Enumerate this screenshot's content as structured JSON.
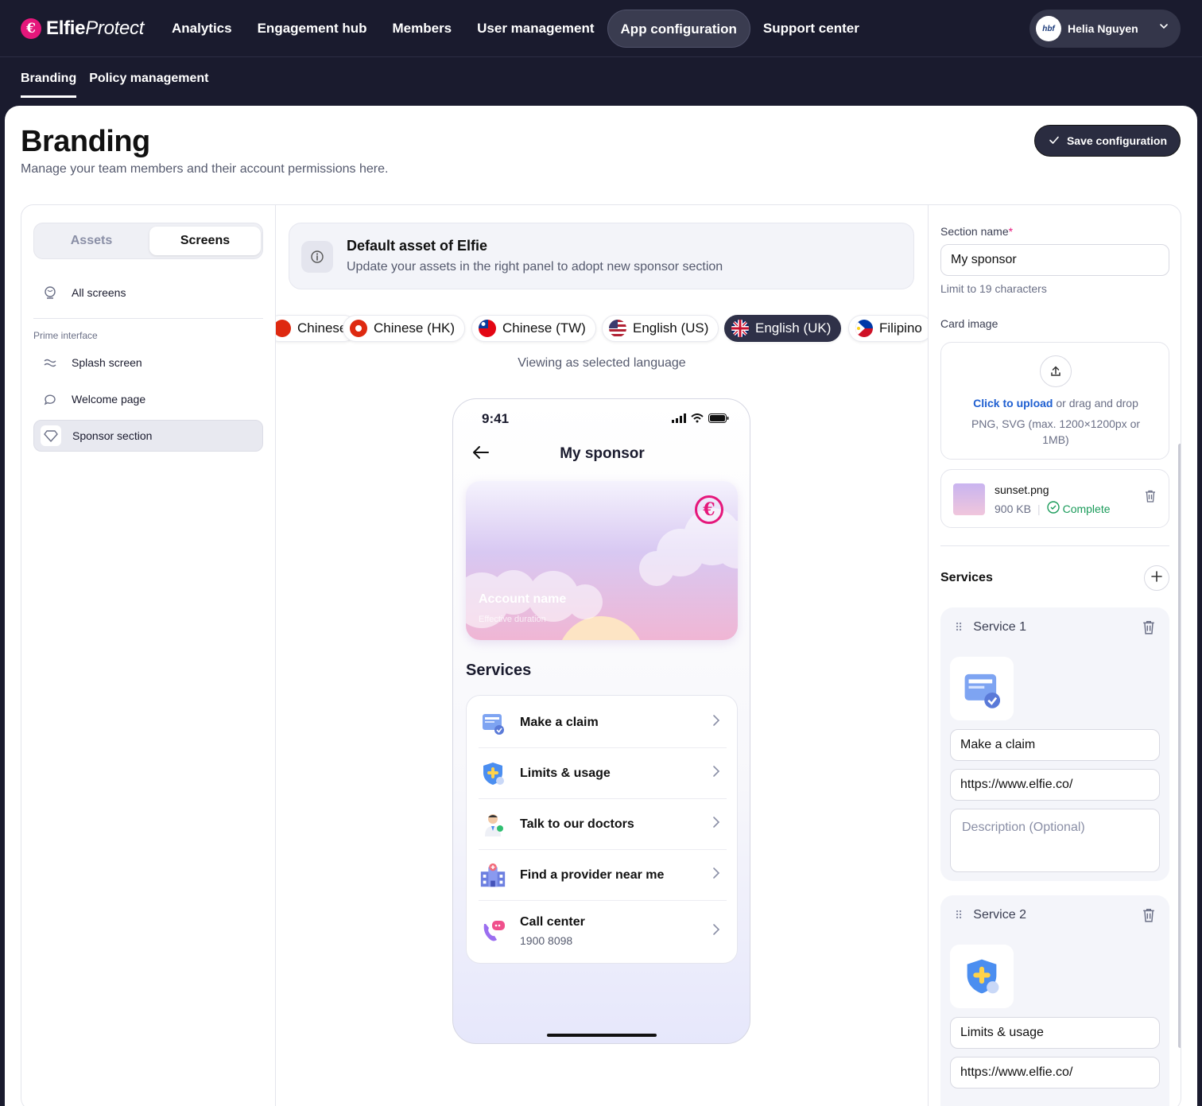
{
  "brand": {
    "name_bold": "Elfie",
    "name_italic": "Protect",
    "mark": "€"
  },
  "nav": {
    "items": [
      {
        "label": "Analytics"
      },
      {
        "label": "Engagement hub"
      },
      {
        "label": "Members"
      },
      {
        "label": "User management"
      },
      {
        "label": "App configuration",
        "active": true
      },
      {
        "label": "Support center"
      }
    ]
  },
  "user": {
    "name": "Helia Nguyen",
    "avatar_text": "hbf"
  },
  "subnav": {
    "items": [
      {
        "label": "Branding",
        "active": true
      },
      {
        "label": "Policy management"
      }
    ]
  },
  "page": {
    "title": "Branding",
    "subtitle": "Manage your team members and their account permissions here.",
    "save_label": "Save configuration"
  },
  "sidebar": {
    "tabs": {
      "assets": "Assets",
      "screens": "Screens",
      "active": "Screens"
    },
    "all_screens": "All screens",
    "group_label": "Prime interface",
    "items": [
      {
        "label": "Splash screen"
      },
      {
        "label": "Welcome page"
      },
      {
        "label": "Sponsor section",
        "active": true
      }
    ]
  },
  "banner": {
    "title": "Default asset of Elfie",
    "subtitle": "Update your assets in the right panel to adopt new sponsor section"
  },
  "languages": {
    "items": [
      {
        "label": "Chinese"
      },
      {
        "label": "Chinese (HK)"
      },
      {
        "label": "Chinese (TW)"
      },
      {
        "label": "English (US)"
      },
      {
        "label": "English (UK)",
        "active": true
      },
      {
        "label": "Filipino"
      }
    ],
    "viewing_text": "Viewing as selected language"
  },
  "phone": {
    "time": "9:41",
    "title": "My sponsor",
    "card": {
      "account_name": "Account name",
      "duration": "Effective duration"
    },
    "services_title": "Services",
    "services": [
      {
        "label": "Make a claim"
      },
      {
        "label": "Limits & usage"
      },
      {
        "label": "Talk to our doctors"
      },
      {
        "label": "Find a provider near me"
      },
      {
        "label": "Call center",
        "sub": "1900 8098"
      }
    ]
  },
  "right": {
    "section_name_label": "Section name",
    "section_name_required": "*",
    "section_name_value": "My sponsor",
    "section_name_hint": "Limit to 19 characters",
    "card_image_label": "Card image",
    "upload": {
      "link": "Click to upload",
      "rest": " or drag and drop",
      "formats": "PNG, SVG (max. 1200×1200px or 1MB)"
    },
    "file": {
      "name": "sunset.png",
      "size": "900 KB",
      "status": "Complete"
    },
    "services_label": "Services",
    "service_blocks": [
      {
        "title": "Service 1",
        "name": "Make a claim",
        "url": "https://www.elfie.co/",
        "desc_placeholder": "Description (Optional)"
      },
      {
        "title": "Service 2",
        "name": "Limits & usage",
        "url": "https://www.elfie.co/"
      }
    ]
  },
  "colors": {
    "accent": "#e5177b",
    "nav_bg": "#1a1b2e",
    "link": "#1f5fd1",
    "success": "#1a9b5a"
  }
}
